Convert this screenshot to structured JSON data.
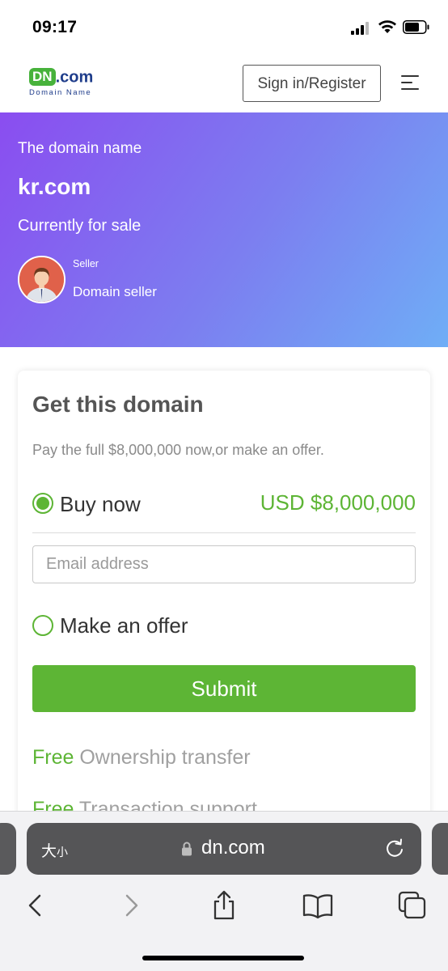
{
  "status_bar": {
    "time": "09:17"
  },
  "header": {
    "logo_badge": "DN",
    "logo_domain": ".com",
    "logo_subtitle": "Domain Name",
    "signin_label": "Sign in/Register"
  },
  "hero": {
    "label": "The domain name",
    "domain": "kr.com",
    "status": "Currently for sale",
    "seller_caption": "Seller",
    "seller_name": "Domain seller"
  },
  "card": {
    "title": "Get this domain",
    "description": "Pay the full $8,000,000 now,or make an offer.",
    "buy_now_label": "Buy now",
    "buy_now_price": "USD $8,000,000",
    "email_placeholder": "Email address",
    "make_offer_label": "Make an offer",
    "submit_label": "Submit",
    "features": [
      {
        "free": "Free",
        "text": " Ownership transfer"
      },
      {
        "free": "Free",
        "text": " Transaction support"
      }
    ]
  },
  "browser": {
    "text_size_label": "大",
    "text_size_small": "小",
    "url": "dn.com"
  },
  "colors": {
    "accent_green": "#5db535",
    "hero_gradient_start": "#8a4df0",
    "hero_gradient_end": "#6faef6",
    "logo_blue": "#1f3d8b"
  },
  "icons": [
    "signal-icon",
    "wifi-icon",
    "battery-icon",
    "menu-icon",
    "lock-icon",
    "reload-icon",
    "back-icon",
    "forward-icon",
    "share-icon",
    "bookmarks-icon",
    "tabs-icon"
  ]
}
